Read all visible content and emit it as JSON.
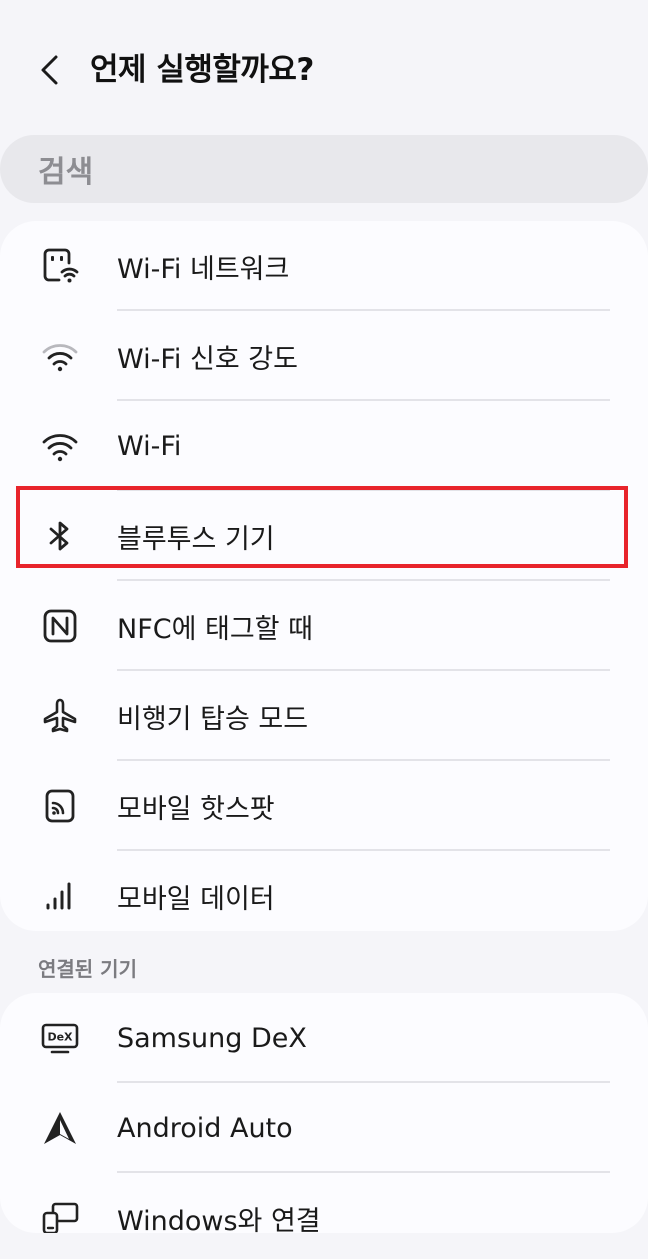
{
  "header": {
    "title": "언제 실행할까요?"
  },
  "search": {
    "placeholder": "검색"
  },
  "triggers": [
    {
      "label": "Wi-Fi 네트워크",
      "icon": "wifi-network-icon"
    },
    {
      "label": "Wi-Fi 신호 강도",
      "icon": "wifi-signal-strength-icon"
    },
    {
      "label": "Wi-Fi",
      "icon": "wifi-icon"
    },
    {
      "label": "블루투스 기기",
      "icon": "bluetooth-icon"
    },
    {
      "label": "NFC에 태그할 때",
      "icon": "nfc-icon"
    },
    {
      "label": "비행기 탑승 모드",
      "icon": "airplane-icon"
    },
    {
      "label": "모바일 핫스팟",
      "icon": "hotspot-icon"
    },
    {
      "label": "모바일 데이터",
      "icon": "mobile-data-icon"
    }
  ],
  "connected_devices": {
    "header": "연결된 기기",
    "items": [
      {
        "label": "Samsung DeX",
        "icon": "dex-icon",
        "icon_text": "DeX"
      },
      {
        "label": "Android Auto",
        "icon": "android-auto-icon"
      },
      {
        "label": "Windows와 연결",
        "icon": "link-to-windows-icon"
      }
    ]
  },
  "colors": {
    "background": "#f5f5f9",
    "card": "#fcfcff",
    "search_bg": "#e8e8ec",
    "highlight": "#e8242b"
  }
}
